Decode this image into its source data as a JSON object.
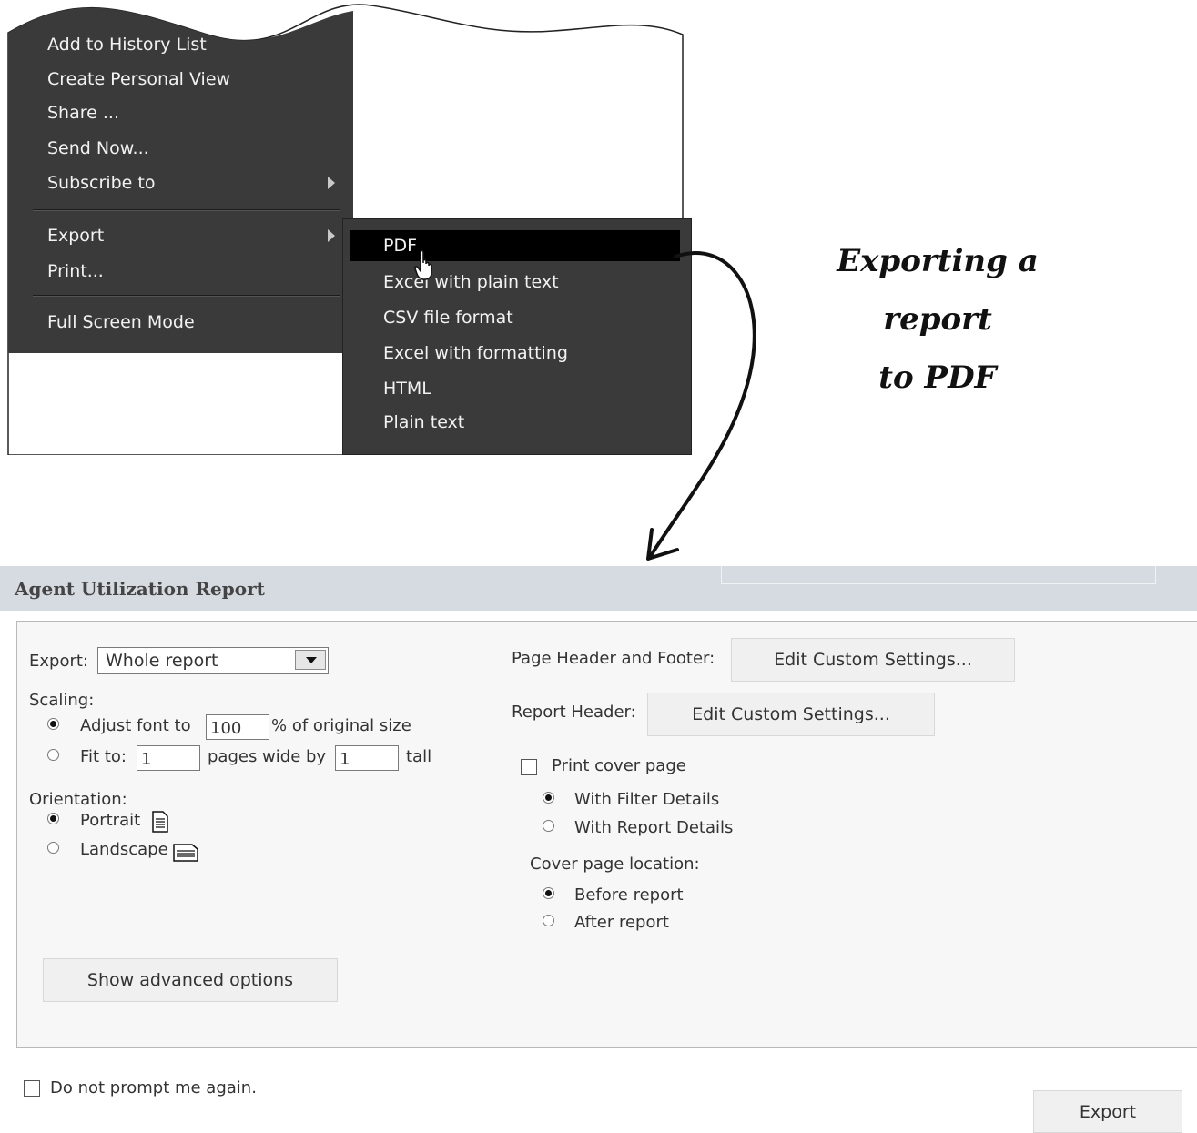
{
  "context_menu": {
    "items": [
      {
        "label": "Add to History List"
      },
      {
        "label": "Create Personal View"
      },
      {
        "label": "Share ..."
      },
      {
        "label": "Send Now..."
      },
      {
        "label": "Subscribe to"
      },
      {
        "label": "Export"
      },
      {
        "label": "Print..."
      },
      {
        "label": "Full Screen Mode"
      }
    ]
  },
  "export_submenu": {
    "items": [
      {
        "label": "PDF"
      },
      {
        "label": "Excel with plain text"
      },
      {
        "label": "CSV file format"
      },
      {
        "label": "Excel with formatting"
      },
      {
        "label": "HTML"
      },
      {
        "label": "Plain text"
      }
    ],
    "highlighted": "PDF"
  },
  "caption": {
    "line1": "Exporting a",
    "line2": "report",
    "line3": "to PDF"
  },
  "dialog": {
    "title": "Agent Utilization Report",
    "export_label": "Export:",
    "export_value": "Whole report",
    "scaling_label": "Scaling:",
    "adjust_font_label": "Adjust font to",
    "adjust_font_value": "100",
    "adjust_font_suffix": "% of original size",
    "fit_to_label": "Fit to:",
    "fit_wide_value": "1",
    "fit_mid_label": "pages wide by",
    "fit_tall_value": "1",
    "fit_tall_suffix": "tall",
    "orientation_label": "Orientation:",
    "portrait_label": "Portrait",
    "landscape_label": "Landscape",
    "show_advanced_button": "Show advanced options",
    "page_header_footer_label": "Page Header and Footer:",
    "page_header_footer_button": "Edit Custom Settings...",
    "report_header_label": "Report Header:",
    "report_header_button": "Edit Custom Settings...",
    "print_cover_label": "Print cover page",
    "with_filter_label": "With Filter Details",
    "with_report_label": "With Report Details",
    "cover_location_label": "Cover page location:",
    "before_report_label": "Before report",
    "after_report_label": "After report",
    "no_prompt_label": "Do not prompt me again.",
    "export_button": "Export",
    "scaling_selected": "adjust_font",
    "orientation_selected": "portrait",
    "cover_details_selected": "with_filter",
    "cover_location_selected": "before_report",
    "print_cover_checked": false,
    "no_prompt_checked": false
  },
  "colors": {
    "menu_bg": "#3a3a3a",
    "menu_highlight": "#000000",
    "dialog_title_bg": "#d6dbe1",
    "panel_bg": "#f7f7f7"
  }
}
